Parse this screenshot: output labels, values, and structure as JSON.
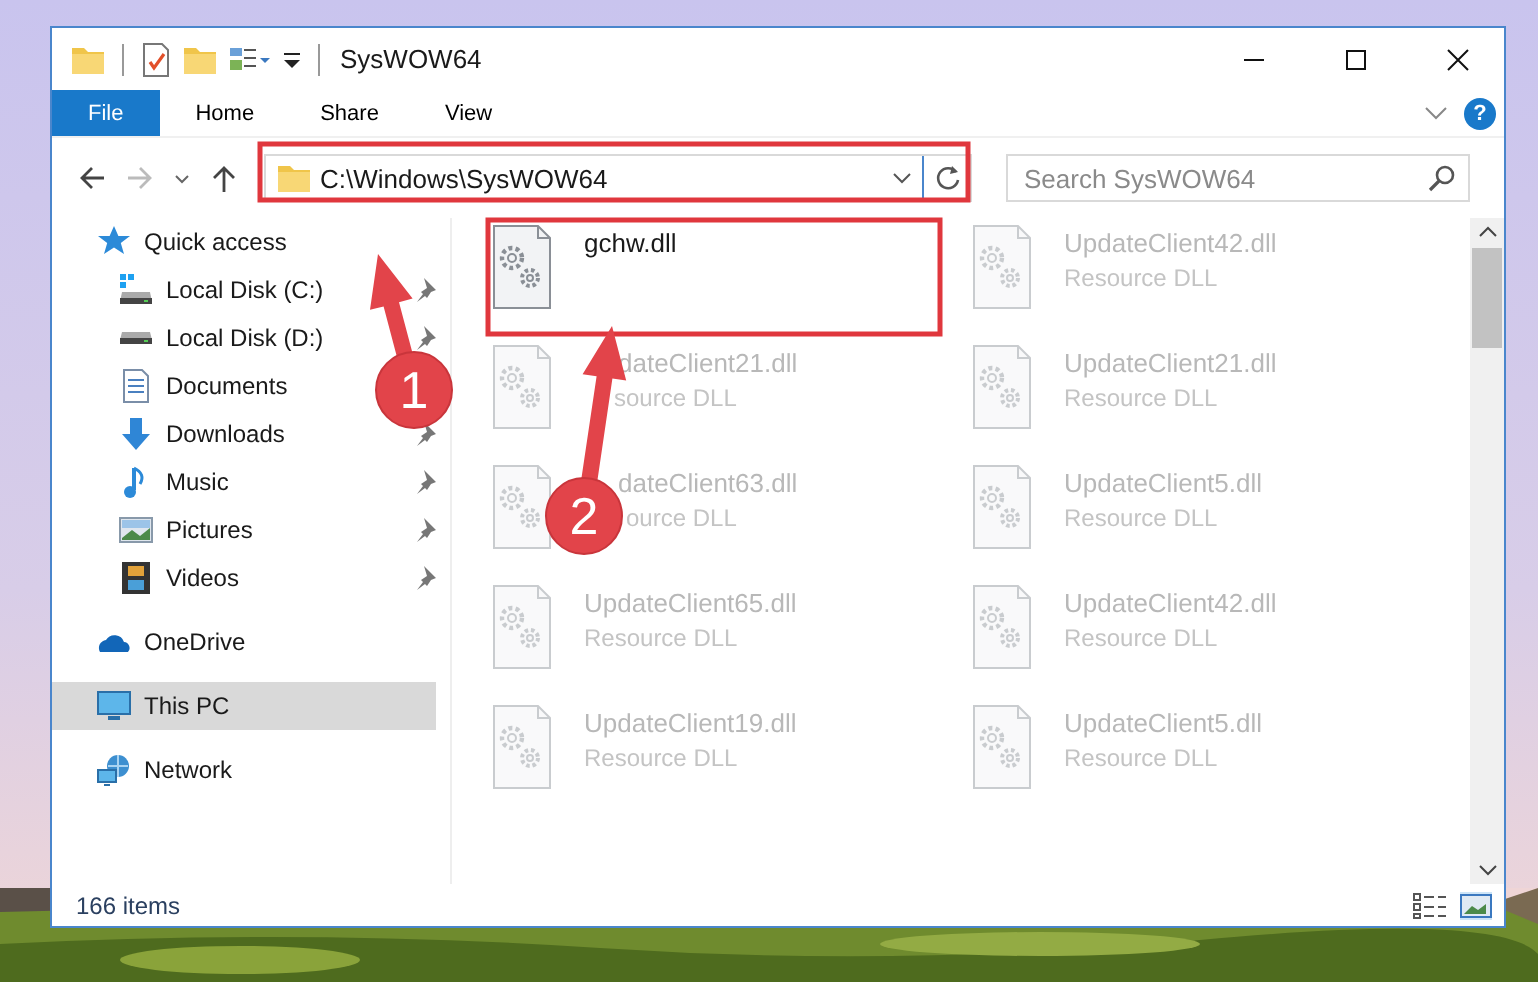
{
  "window": {
    "title": "SysWOW64"
  },
  "ribbon": {
    "tabs": [
      {
        "label": "File",
        "selected": true
      },
      {
        "label": "Home",
        "selected": false
      },
      {
        "label": "Share",
        "selected": false
      },
      {
        "label": "View",
        "selected": false
      }
    ],
    "help": "?"
  },
  "address_bar": {
    "path": "C:\\Windows\\SysWOW64"
  },
  "search": {
    "placeholder": "Search SysWOW64"
  },
  "sidebar": {
    "items": [
      {
        "label": "Quick access",
        "selected": false,
        "children": [
          {
            "label": "Local Disk (C:)",
            "pinned": true
          },
          {
            "label": "Local Disk (D:)",
            "pinned": true
          },
          {
            "label": "Documents",
            "pinned": false
          },
          {
            "label": "Downloads",
            "pinned": true
          },
          {
            "label": "Music",
            "pinned": true
          },
          {
            "label": "Pictures",
            "pinned": true
          },
          {
            "label": "Videos",
            "pinned": true
          }
        ]
      },
      {
        "label": "OneDrive",
        "selected": false
      },
      {
        "label": "This PC",
        "selected": true
      },
      {
        "label": "Network",
        "selected": false
      }
    ]
  },
  "files": [
    {
      "name": "gchw.dll",
      "blurred": false
    },
    {
      "name": "UpdateClient42.dll",
      "type": "Resource DLL",
      "blurred": true
    },
    {
      "name": "dateClient21.dll",
      "type": "source DLL",
      "blurred": true
    },
    {
      "name": "UpdateClient21.dll",
      "type": "Resource DLL",
      "blurred": true
    },
    {
      "name": "dateClient63.dll",
      "type": "ource DLL",
      "blurred": true
    },
    {
      "name": "UpdateClient5.dll",
      "type": "Resource DLL",
      "blurred": true
    },
    {
      "name": "UpdateClient65.dll",
      "type": "Resource DLL",
      "blurred": true
    },
    {
      "name": "UpdateClient42.dll",
      "type": "Resource DLL",
      "blurred": true
    },
    {
      "name": "UpdateClient19.dll",
      "type": "Resource DLL",
      "blurred": true
    },
    {
      "name": "UpdateClient5.dll",
      "type": "Resource DLL",
      "blurred": true
    }
  ],
  "status_bar": {
    "count": "166 items"
  },
  "callouts": [
    {
      "label": "1"
    },
    {
      "label": "2"
    }
  ]
}
